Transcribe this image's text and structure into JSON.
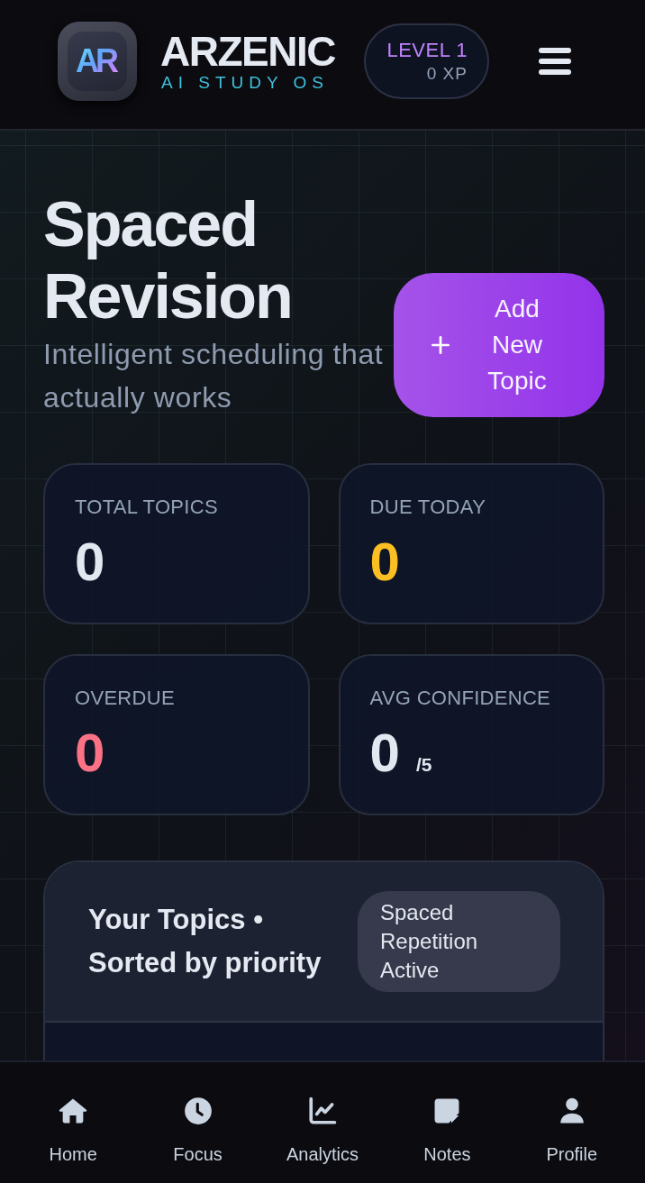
{
  "header": {
    "logo": {
      "mark": "AR"
    },
    "brand": {
      "name": "ARZENIC",
      "tagline": "AI STUDY OS"
    },
    "level": {
      "label": "LEVEL 1",
      "xp": "0 XP"
    }
  },
  "page": {
    "title": "Spaced Revision",
    "subtitle": "Intelligent scheduling that actually works",
    "add_button": {
      "label": "Add New Topic"
    }
  },
  "stats": [
    {
      "label": "TOTAL TOPICS",
      "value": "0",
      "color": "#e2e8f0"
    },
    {
      "label": "DUE TODAY",
      "value": "0",
      "color": "#fbbf24"
    },
    {
      "label": "OVERDUE",
      "value": "0",
      "color": "#fb7185"
    },
    {
      "label": "AVG CONFIDENCE",
      "value": "0",
      "suffix": "/5",
      "color": "#e2e8f0"
    }
  ],
  "topics": {
    "title": "Your Topics • Sorted by priority",
    "badge": "Spaced Repetition Active"
  },
  "bottom_nav": [
    {
      "label": "Home"
    },
    {
      "label": "Focus"
    },
    {
      "label": "Analytics"
    },
    {
      "label": "Notes"
    },
    {
      "label": "Profile"
    }
  ]
}
